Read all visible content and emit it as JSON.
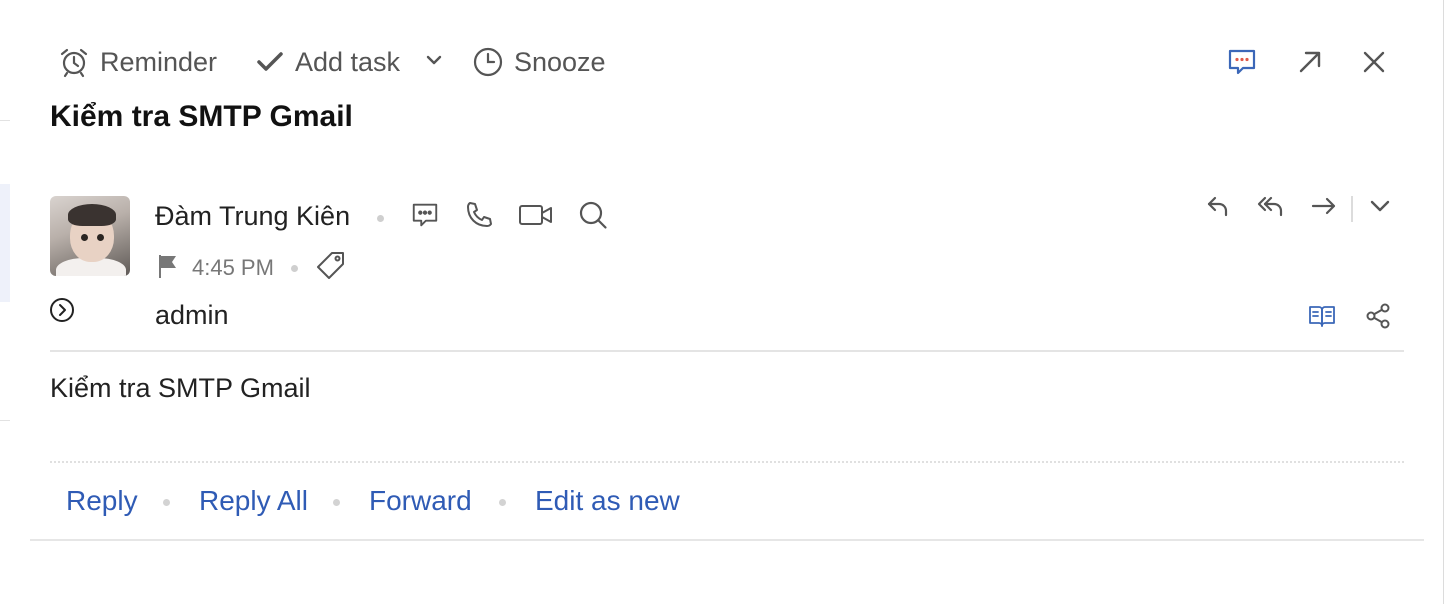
{
  "toolbar": {
    "reminder_label": "Reminder",
    "add_task_label": "Add task",
    "snooze_label": "Snooze"
  },
  "message": {
    "subject": "Kiểm tra SMTP Gmail",
    "sender_name": "Đàm Trung Kiên",
    "time": "4:45 PM",
    "to": "admin",
    "body": "Kiểm tra SMTP Gmail"
  },
  "actions": {
    "reply": "Reply",
    "reply_all": "Reply All",
    "forward": "Forward",
    "edit_as_new": "Edit as new"
  },
  "icons": {
    "reminder": "alarm-clock-icon",
    "add_task": "checkmark-icon",
    "snooze": "clock-icon",
    "chat": "chat-icon",
    "popout": "arrow-up-right-icon",
    "close": "close-icon",
    "call": "phone-icon",
    "video": "video-camera-icon",
    "search": "search-icon",
    "flag": "flag-icon",
    "tag": "tag-icon",
    "reply": "reply-icon",
    "reply_all": "reply-all-icon",
    "forward": "forward-icon",
    "expand": "chevron-down-icon",
    "details_toggle": "chevron-right-circle-icon",
    "reader": "book-icon",
    "share": "share-icon"
  },
  "colors": {
    "link": "#2f5bb5",
    "icon_gray": "#555555",
    "icon_blue": "#3b67b8",
    "chat_dots": "#e05a4a"
  }
}
